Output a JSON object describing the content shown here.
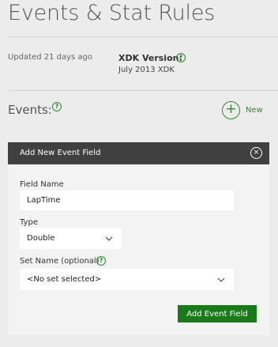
{
  "page": {
    "title": "Events & Stat Rules",
    "updated": "Updated 21 days ago",
    "xdk_label": "XDK Version:",
    "xdk_value": "July 2013 XDK",
    "events_label": "Events:",
    "new_label": "New"
  },
  "help_glyph": "?",
  "new_glyph": "+",
  "panel": {
    "title": "Add New Event Field",
    "close_glyph": "×",
    "field_name_label": "Field Name",
    "field_name_value": "LapTime",
    "type_label": "Type",
    "type_value": "Double",
    "set_name_label": "Set Name (optional)",
    "set_name_value": "<No set selected>",
    "submit_label": "Add Event Field"
  },
  "colors": {
    "accent_green": "#2e8b2e",
    "button_green": "#1a7a1a",
    "header_dark": "#404040"
  }
}
